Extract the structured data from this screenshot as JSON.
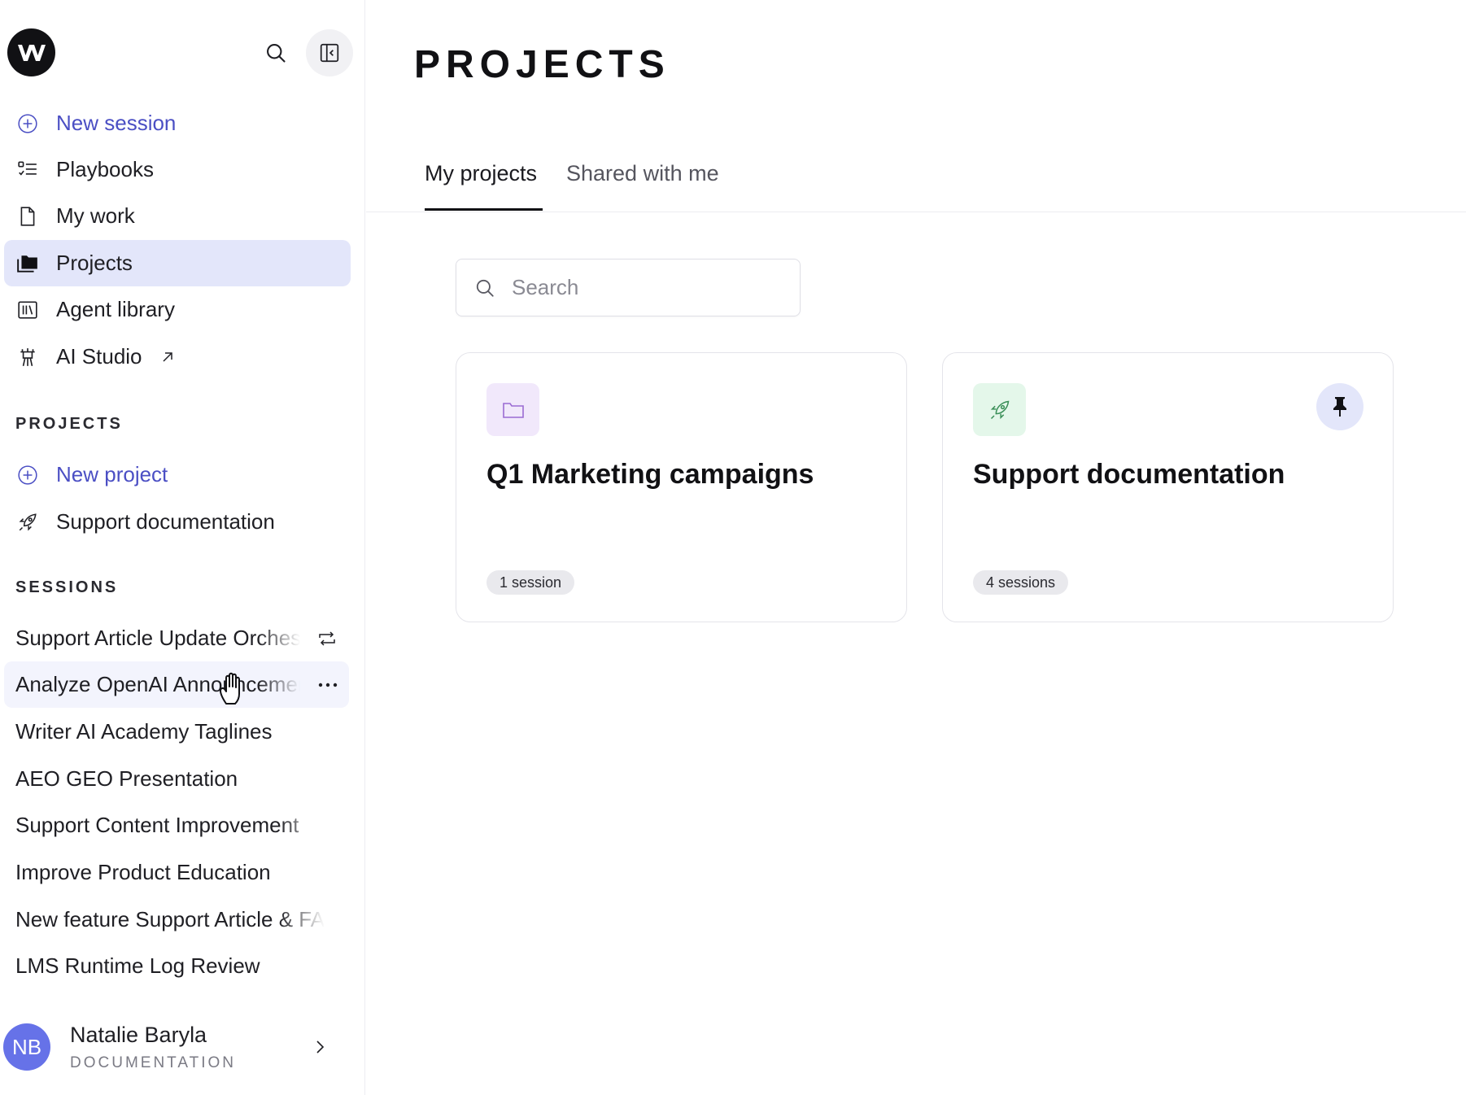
{
  "sidebar": {
    "logo_letter": "W",
    "nav": [
      {
        "label": "New session",
        "icon": "plus-circle-icon"
      },
      {
        "label": "Playbooks",
        "icon": "checklist-icon"
      },
      {
        "label": "My work",
        "icon": "document-icon"
      },
      {
        "label": "Projects",
        "icon": "folder-stack-icon",
        "active": true
      },
      {
        "label": "Agent library",
        "icon": "library-icon"
      },
      {
        "label": "AI Studio",
        "icon": "studio-icon",
        "external": true
      }
    ],
    "projects_heading": "PROJECTS",
    "projects": [
      {
        "label": "New project",
        "icon": "plus-circle-icon"
      },
      {
        "label": "Support documentation",
        "icon": "rocket-icon"
      }
    ],
    "sessions_heading": "SESSIONS",
    "sessions": [
      {
        "label": "Support Article Update Orchestration",
        "trail": "repeat-icon"
      },
      {
        "label": "Analyze OpenAI Announcement",
        "trail": "more-icon"
      },
      {
        "label": "Writer AI Academy Taglines"
      },
      {
        "label": "AEO GEO Presentation"
      },
      {
        "label": "Support Content Improvement"
      },
      {
        "label": "Improve Product Education"
      },
      {
        "label": "New feature Support Article & FAQ"
      },
      {
        "label": "LMS Runtime Log Review"
      }
    ],
    "user": {
      "initials": "NB",
      "name": "Natalie Baryla",
      "org": "DOCUMENTATION"
    }
  },
  "main": {
    "title": "PROJECTS",
    "tabs": [
      {
        "label": "My projects",
        "active": true
      },
      {
        "label": "Shared with me"
      }
    ],
    "search": {
      "placeholder": "Search",
      "value": ""
    },
    "cards": [
      {
        "title": "Q1 Marketing campaigns",
        "badge": "1 session",
        "icon": "folder-icon",
        "icon_bg": "#f1e8fb"
      },
      {
        "title": "Support documentation",
        "badge": "4 sessions",
        "icon": "rocket-icon",
        "icon_bg": "#e4f7ea",
        "pinned": true
      }
    ]
  },
  "colors": {
    "accent": "#4b4fc4",
    "active_nav_bg": "#e3e6fa",
    "avatar": "#6672e8"
  }
}
